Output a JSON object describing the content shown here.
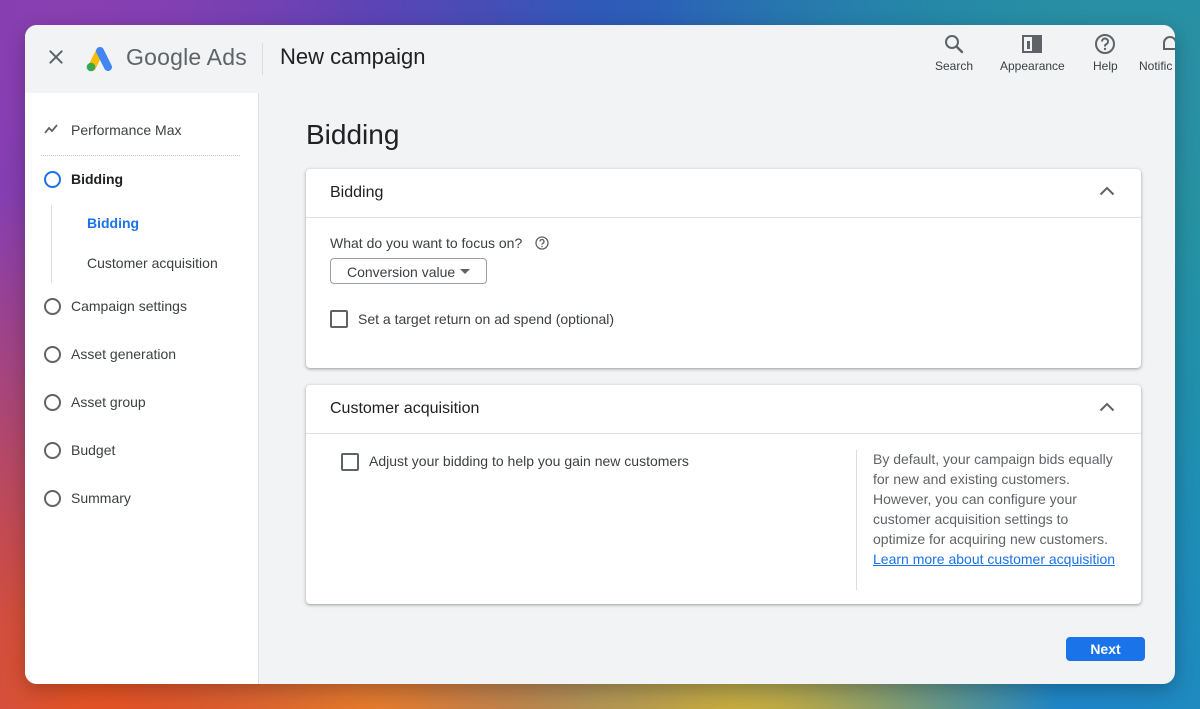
{
  "colors": {
    "accent": "#1a73e8",
    "window_bg": "#f1f3f4",
    "card_bg": "#ffffff",
    "text": "#3c4043"
  },
  "header": {
    "brand": "Google Ads",
    "title": "New campaign",
    "tools": [
      {
        "label": "Search",
        "icon": "search-icon"
      },
      {
        "label": "Appearance",
        "icon": "appearance-icon"
      },
      {
        "label": "Help",
        "icon": "help-icon"
      },
      {
        "label": "Notific",
        "icon": "bell-icon"
      }
    ]
  },
  "sidebar": {
    "campaign_type": "Performance Max",
    "items": [
      {
        "label": "Bidding",
        "state": "active"
      },
      {
        "label": "Campaign settings"
      },
      {
        "label": "Asset generation"
      },
      {
        "label": "Asset group"
      },
      {
        "label": "Budget"
      },
      {
        "label": "Summary"
      }
    ],
    "sub_items": [
      {
        "label": "Bidding",
        "state": "selected"
      },
      {
        "label": "Customer acquisition"
      }
    ]
  },
  "main": {
    "heading": "Bidding",
    "bidding_card": {
      "title": "Bidding",
      "focus_question": "What do you want to focus on?",
      "focus_value": "Conversion value",
      "checkbox_label": "Set a target return on ad spend (optional)"
    },
    "acquisition_card": {
      "title": "Customer acquisition",
      "checkbox_label": "Adjust your bidding to help you gain new customers",
      "info_text": "By default, your campaign bids equally for new and existing customers. However, you can configure your customer acquisition settings to optimize for acquiring new customers. ",
      "info_link": "Learn more about customer acquisition"
    },
    "next_label": "Next"
  }
}
